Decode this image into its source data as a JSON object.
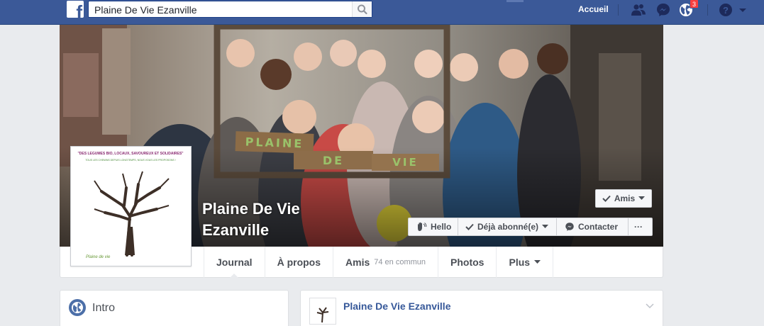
{
  "topbar": {
    "search_value": "Plaine De Vie Ezanville",
    "home_label": "Accueil",
    "notification_count": "3",
    "brand_color": "#3b5998"
  },
  "page": {
    "name_line1": "Plaine De Vie",
    "name_line2": "Ezanville"
  },
  "actions": {
    "friends": "Amis",
    "hello": "Hello",
    "subscribed": "Déjà abonné(e)",
    "contact": "Contacter",
    "more": "···"
  },
  "cover_sign": {
    "word1": "PLAINE",
    "word2": "DE",
    "word3": "VIE"
  },
  "avatar": {
    "slogan": "\"DES LEGUMES BIO, LOCAUX, SAVOUREUX ET SOLIDAIRES\"",
    "subline": "TOUS LES CHEMINS DEPUIS LONGTEMPS, NOUS VOUS LES PROPOSONS !",
    "brand": "Plaine de vie"
  },
  "tabs": [
    {
      "label": "Journal",
      "sub": ""
    },
    {
      "label": "À propos",
      "sub": ""
    },
    {
      "label": "Amis",
      "sub": "74 en commun"
    },
    {
      "label": "Photos",
      "sub": ""
    },
    {
      "label": "Plus",
      "sub": ""
    }
  ],
  "intro": {
    "title": "Intro"
  },
  "post": {
    "author": "Plaine De Vie Ezanville"
  }
}
